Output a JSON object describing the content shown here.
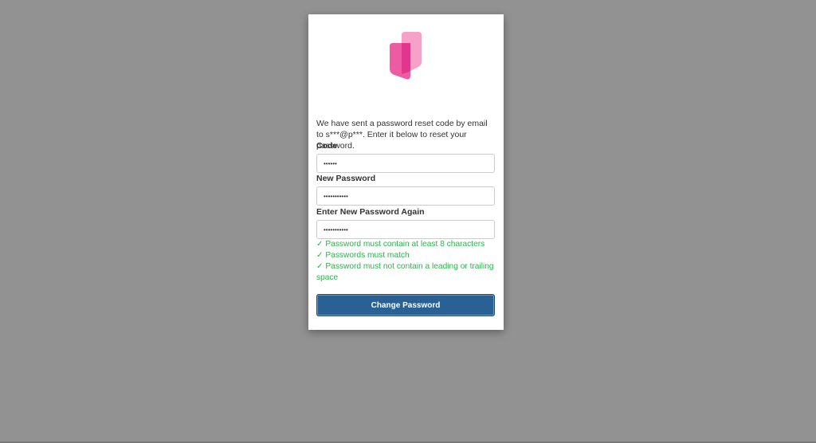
{
  "colors": {
    "background": "#929292",
    "card": "#ffffff",
    "logo_light": "#f7a0c8",
    "logo_dark": "#ec4d9b",
    "success_text": "#2bb34a",
    "button": "#2a6194"
  },
  "logo": {
    "icon": "brand-logo-icon"
  },
  "message": "We have sent a password reset code by email to s***@p***. Enter it below to reset your password.",
  "form": {
    "code_label": "Code",
    "code_value": "••••••",
    "new_password_label": "New Password",
    "new_password_value": "•••••••••••",
    "confirm_password_label": "Enter New Password Again",
    "confirm_password_value": "•••••••••••"
  },
  "rules": [
    "✓ Password must contain at least 8 characters",
    "✓ Passwords must match",
    "✓ Password must not contain a leading or trailing space"
  ],
  "button_label": "Change Password"
}
